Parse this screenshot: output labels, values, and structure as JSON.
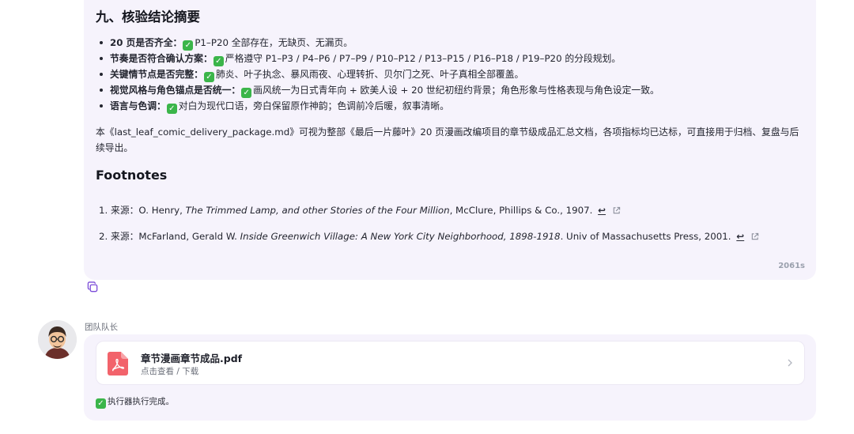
{
  "report": {
    "section_title": "九、核验结论摘要",
    "bullets": [
      {
        "key": "20 页是否齐全：",
        "text": "P1–P20 全部存在，无缺页、无漏页。"
      },
      {
        "key": "节奏是否符合确认方案：",
        "text": "严格遵守 P1–P3 / P4–P6 / P7–P9 / P10–P12 / P13–P15 / P16–P18 / P19–P20 的分段规划。"
      },
      {
        "key": "关键情节点是否完整：",
        "text": "肺炎、叶子执念、暴风雨夜、心理转折、贝尔门之死、叶子真相全部覆盖。"
      },
      {
        "key": "视觉风格与角色锚点是否统一：",
        "text": "画风统一为日式青年向 + 欧美人设 + 20 世纪初纽约背景；角色形象与性格表现与角色设定一致。"
      },
      {
        "key": "语言与色调：",
        "text": "对白为现代口语，旁白保留原作神韵；色调前冷后暖，叙事清晰。"
      }
    ],
    "summary": "本《last_leaf_comic_delivery_package.md》可视为整部《最后一片藤叶》20 页漫画改编项目的章节级成品汇总文档，各项指标均已达标，可直接用于归档、复盘与后续导出。",
    "footnotes_title": "Footnotes",
    "footnotes": [
      {
        "num": "1.",
        "prefix": "来源：O. Henry, ",
        "italic": "The Trimmed Lamp, and other Stories of the Four Million",
        "suffix": ", McClure, Phillips & Co., 1907.",
        "back": "↩"
      },
      {
        "num": "2.",
        "prefix": "来源：McFarland, Gerald W. ",
        "italic": "Inside Greenwich Village: A New York City Neighborhood, 1898-1918",
        "suffix": ". Univ of Massachusetts Press, 2001.",
        "back": "↩"
      }
    ],
    "elapsed": "2061s"
  },
  "team_lead": {
    "label": "团队队长",
    "file": {
      "name": "章节漫画章节成品.pdf",
      "sub": "点击查看 / 下载"
    },
    "status": "执行器执行完成。"
  },
  "icons": {
    "check": "check-mark-icon",
    "copy": "copy-icon",
    "external": "external-link-icon",
    "pdf": "pdf-file-icon",
    "chevron": "chevron-right-icon"
  },
  "colors": {
    "bubble": "#f6f3fc",
    "check": "#3bb54a",
    "accent": "#7b4cd8",
    "pdf": "#f2636b"
  }
}
